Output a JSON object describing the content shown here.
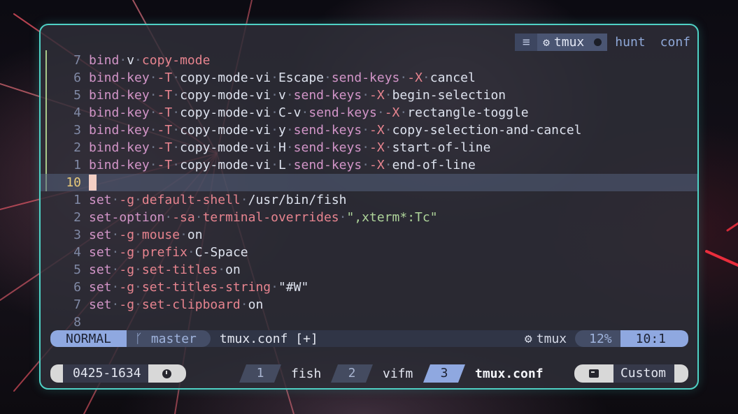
{
  "tabline": {
    "menu_icon": "hamburger-icon",
    "active_icon": "gear-icon",
    "active_label": "tmux",
    "modified_marker": "dot",
    "others": [
      "hunt",
      "conf"
    ]
  },
  "buffer": {
    "lines": [
      {
        "n": "7",
        "parts": [
          [
            "k",
            "bind"
          ],
          [
            "d",
            "·"
          ],
          [
            "t",
            "v"
          ],
          [
            "d",
            "·"
          ],
          [
            "f",
            "copy-mode"
          ]
        ]
      },
      {
        "n": "6",
        "parts": [
          [
            "k",
            "bind-key"
          ],
          [
            "d",
            "·"
          ],
          [
            "f",
            "-T"
          ],
          [
            "d",
            "·"
          ],
          [
            "t",
            "copy-mode-vi"
          ],
          [
            "d",
            "·"
          ],
          [
            "t",
            "Escape"
          ],
          [
            "d",
            "·"
          ],
          [
            "k",
            "send-keys"
          ],
          [
            "d",
            "·"
          ],
          [
            "f",
            "-X"
          ],
          [
            "d",
            "·"
          ],
          [
            "t",
            "cancel"
          ]
        ]
      },
      {
        "n": "5",
        "parts": [
          [
            "k",
            "bind-key"
          ],
          [
            "d",
            "·"
          ],
          [
            "f",
            "-T"
          ],
          [
            "d",
            "·"
          ],
          [
            "t",
            "copy-mode-vi"
          ],
          [
            "d",
            "·"
          ],
          [
            "t",
            "v"
          ],
          [
            "d",
            "·"
          ],
          [
            "k",
            "send-keys"
          ],
          [
            "d",
            "·"
          ],
          [
            "f",
            "-X"
          ],
          [
            "d",
            "·"
          ],
          [
            "t",
            "begin-selection"
          ]
        ]
      },
      {
        "n": "4",
        "parts": [
          [
            "k",
            "bind-key"
          ],
          [
            "d",
            "·"
          ],
          [
            "f",
            "-T"
          ],
          [
            "d",
            "·"
          ],
          [
            "t",
            "copy-mode-vi"
          ],
          [
            "d",
            "·"
          ],
          [
            "t",
            "C-v"
          ],
          [
            "d",
            "·"
          ],
          [
            "k",
            "send-keys"
          ],
          [
            "d",
            "·"
          ],
          [
            "f",
            "-X"
          ],
          [
            "d",
            "·"
          ],
          [
            "t",
            "rectangle-toggle"
          ]
        ]
      },
      {
        "n": "3",
        "parts": [
          [
            "k",
            "bind-key"
          ],
          [
            "d",
            "·"
          ],
          [
            "f",
            "-T"
          ],
          [
            "d",
            "·"
          ],
          [
            "t",
            "copy-mode-vi"
          ],
          [
            "d",
            "·"
          ],
          [
            "t",
            "y"
          ],
          [
            "d",
            "·"
          ],
          [
            "k",
            "send-keys"
          ],
          [
            "d",
            "·"
          ],
          [
            "f",
            "-X"
          ],
          [
            "d",
            "·"
          ],
          [
            "t",
            "copy-selection-and-cancel"
          ]
        ]
      },
      {
        "n": "2",
        "parts": [
          [
            "k",
            "bind-key"
          ],
          [
            "d",
            "·"
          ],
          [
            "f",
            "-T"
          ],
          [
            "d",
            "·"
          ],
          [
            "t",
            "copy-mode-vi"
          ],
          [
            "d",
            "·"
          ],
          [
            "t",
            "H"
          ],
          [
            "d",
            "·"
          ],
          [
            "k",
            "send-keys"
          ],
          [
            "d",
            "·"
          ],
          [
            "f",
            "-X"
          ],
          [
            "d",
            "·"
          ],
          [
            "t",
            "start-of-line"
          ]
        ]
      },
      {
        "n": "1",
        "parts": [
          [
            "k",
            "bind-key"
          ],
          [
            "d",
            "·"
          ],
          [
            "f",
            "-T"
          ],
          [
            "d",
            "·"
          ],
          [
            "t",
            "copy-mode-vi"
          ],
          [
            "d",
            "·"
          ],
          [
            "t",
            "L"
          ],
          [
            "d",
            "·"
          ],
          [
            "k",
            "send-keys"
          ],
          [
            "d",
            "·"
          ],
          [
            "f",
            "-X"
          ],
          [
            "d",
            "·"
          ],
          [
            "t",
            "end-of-line"
          ]
        ]
      },
      {
        "n": "10",
        "current": true,
        "parts": []
      },
      {
        "n": "1",
        "parts": [
          [
            "k",
            "set"
          ],
          [
            "d",
            "·"
          ],
          [
            "f",
            "-g"
          ],
          [
            "d",
            "·"
          ],
          [
            "f",
            "default-shell"
          ],
          [
            "d",
            "·"
          ],
          [
            "t",
            "/usr/bin/fish"
          ]
        ]
      },
      {
        "n": "2",
        "parts": [
          [
            "k",
            "set-option"
          ],
          [
            "d",
            "·"
          ],
          [
            "f",
            "-sa"
          ],
          [
            "d",
            "·"
          ],
          [
            "f",
            "terminal-overrides"
          ],
          [
            "d",
            "·"
          ],
          [
            "s",
            "\",xterm*:Tc\""
          ]
        ]
      },
      {
        "n": "3",
        "parts": [
          [
            "k",
            "set"
          ],
          [
            "d",
            "·"
          ],
          [
            "f",
            "-g"
          ],
          [
            "d",
            "·"
          ],
          [
            "f",
            "mouse"
          ],
          [
            "d",
            "·"
          ],
          [
            "t",
            "on"
          ]
        ]
      },
      {
        "n": "4",
        "parts": [
          [
            "k",
            "set"
          ],
          [
            "d",
            "·"
          ],
          [
            "f",
            "-g"
          ],
          [
            "d",
            "·"
          ],
          [
            "f",
            "prefix"
          ],
          [
            "d",
            "·"
          ],
          [
            "t",
            "C-Space"
          ]
        ]
      },
      {
        "n": "5",
        "parts": [
          [
            "k",
            "set"
          ],
          [
            "d",
            "·"
          ],
          [
            "f",
            "-g"
          ],
          [
            "d",
            "·"
          ],
          [
            "f",
            "set-titles"
          ],
          [
            "d",
            "·"
          ],
          [
            "t",
            "on"
          ]
        ]
      },
      {
        "n": "6",
        "parts": [
          [
            "k",
            "set"
          ],
          [
            "d",
            "·"
          ],
          [
            "f",
            "-g"
          ],
          [
            "d",
            "·"
          ],
          [
            "f",
            "set-titles-string"
          ],
          [
            "d",
            "·"
          ],
          [
            "t",
            "\"#W\""
          ]
        ]
      },
      {
        "n": "7",
        "parts": [
          [
            "k",
            "set"
          ],
          [
            "d",
            "·"
          ],
          [
            "f",
            "-g"
          ],
          [
            "d",
            "·"
          ],
          [
            "f",
            "set-clipboard"
          ],
          [
            "d",
            "·"
          ],
          [
            "t",
            "on"
          ]
        ]
      },
      {
        "n": "8",
        "parts": []
      }
    ]
  },
  "statusline": {
    "mode": "NORMAL",
    "branch_icon": "git-branch-icon",
    "branch": "master",
    "file": "tmux.conf [+]",
    "filetype_icon": "gear-icon",
    "filetype": "tmux",
    "percent": "12%",
    "position": "10:1"
  },
  "tmux": {
    "date": "0425-1634",
    "clock_icon": "clock-icon",
    "windows": [
      {
        "index": "1",
        "name": "fish",
        "active": false
      },
      {
        "index": "2",
        "name": "vifm",
        "active": false
      },
      {
        "index": "3",
        "name": "tmux.conf",
        "active": true
      }
    ],
    "session_icon": "terminal-icon",
    "session": "Custom"
  },
  "colors": {
    "border": "#4fd1c5",
    "accent": "#8fa8e0",
    "keyword": "#d295c8",
    "flag": "#e7848f",
    "string": "#aed49a",
    "current_line_nr": "#e8c97a"
  }
}
